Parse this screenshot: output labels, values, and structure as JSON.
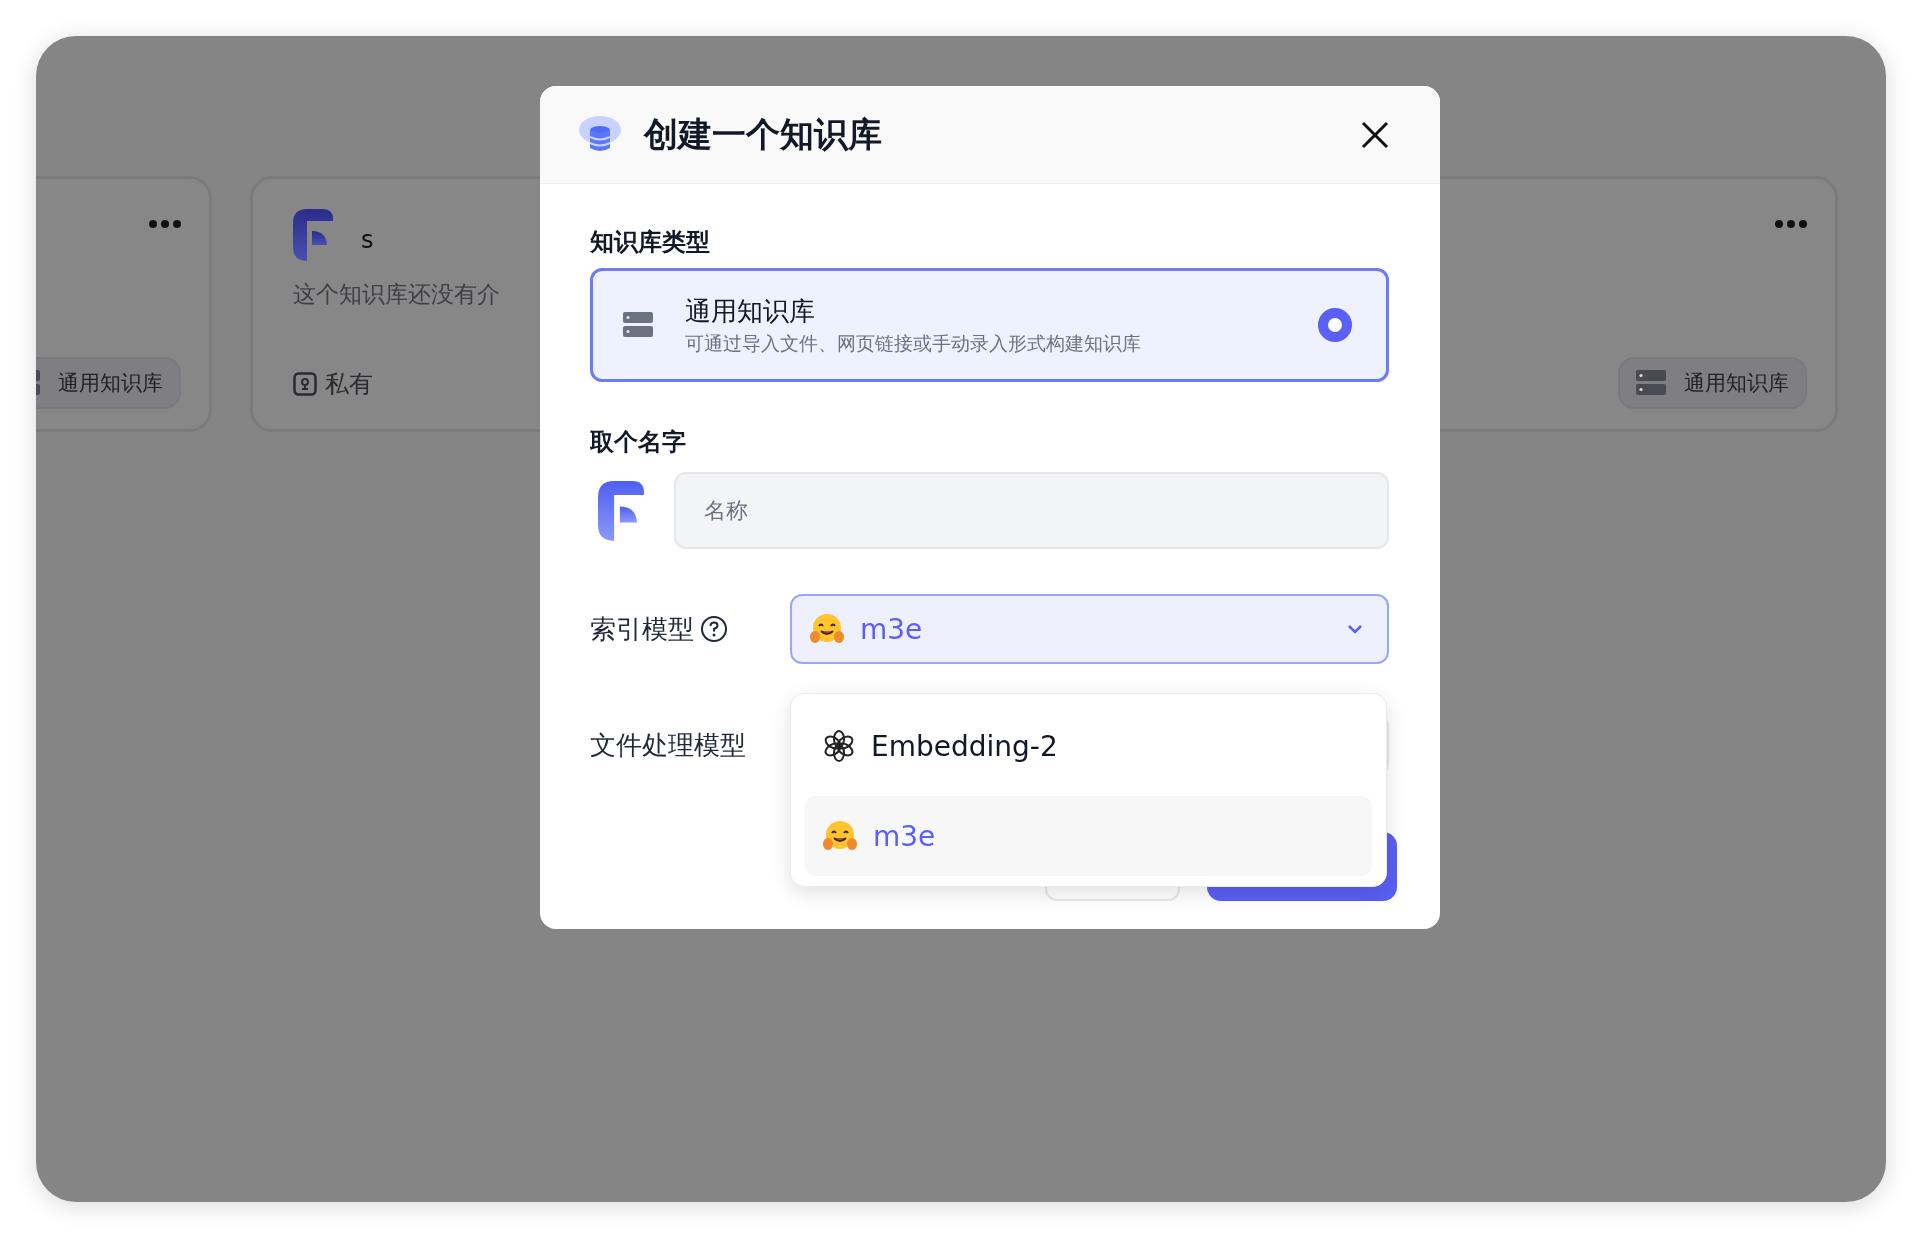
{
  "background_cards": [
    {
      "kind": "tag",
      "tag": "通用知识库"
    },
    {
      "kind": "info",
      "name": "s",
      "description": "这个知识库还没有介",
      "visibility": "私有"
    },
    {
      "kind": "tag",
      "tag": "通用知识库"
    }
  ],
  "dialog": {
    "title": "创建一个知识库",
    "type_section": {
      "label": "知识库类型",
      "options": [
        {
          "title": "通用知识库",
          "description": "可通过导入文件、网页链接或手动录入形式构建知识库",
          "selected": true
        }
      ]
    },
    "name_section": {
      "label": "取个名字",
      "placeholder": "名称"
    },
    "index_model": {
      "label": "索引模型",
      "value": "m3e",
      "expanded": true,
      "options": [
        {
          "label": "Embedding-2",
          "kind": "openai",
          "selected": false
        },
        {
          "label": "m3e",
          "kind": "hug",
          "selected": true
        }
      ]
    },
    "file_model": {
      "label": "文件处理模型"
    }
  }
}
